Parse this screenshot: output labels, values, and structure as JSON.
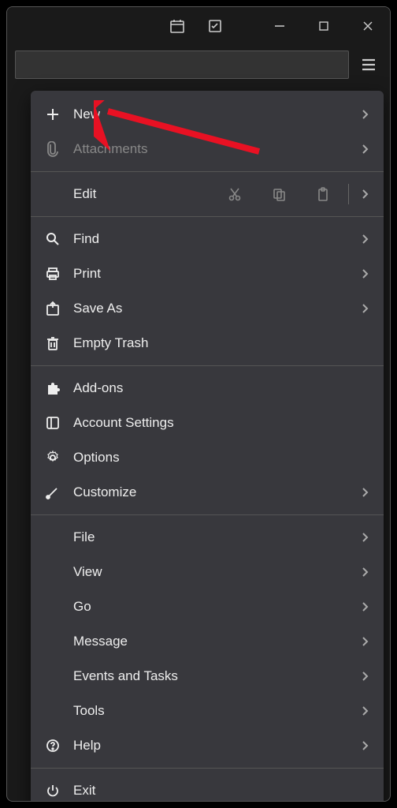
{
  "titlebar": {
    "icons": {
      "calendar": "calendar-icon",
      "tasks": "tasks-icon"
    }
  },
  "menu": {
    "new": "New",
    "attachments": "Attachments",
    "edit": "Edit",
    "find": "Find",
    "print": "Print",
    "save_as": "Save As",
    "empty_trash": "Empty Trash",
    "addons": "Add-ons",
    "account_settings": "Account Settings",
    "options": "Options",
    "customize": "Customize",
    "file": "File",
    "view": "View",
    "go": "Go",
    "message": "Message",
    "events_tasks": "Events and Tasks",
    "tools": "Tools",
    "help": "Help",
    "exit": "Exit"
  }
}
